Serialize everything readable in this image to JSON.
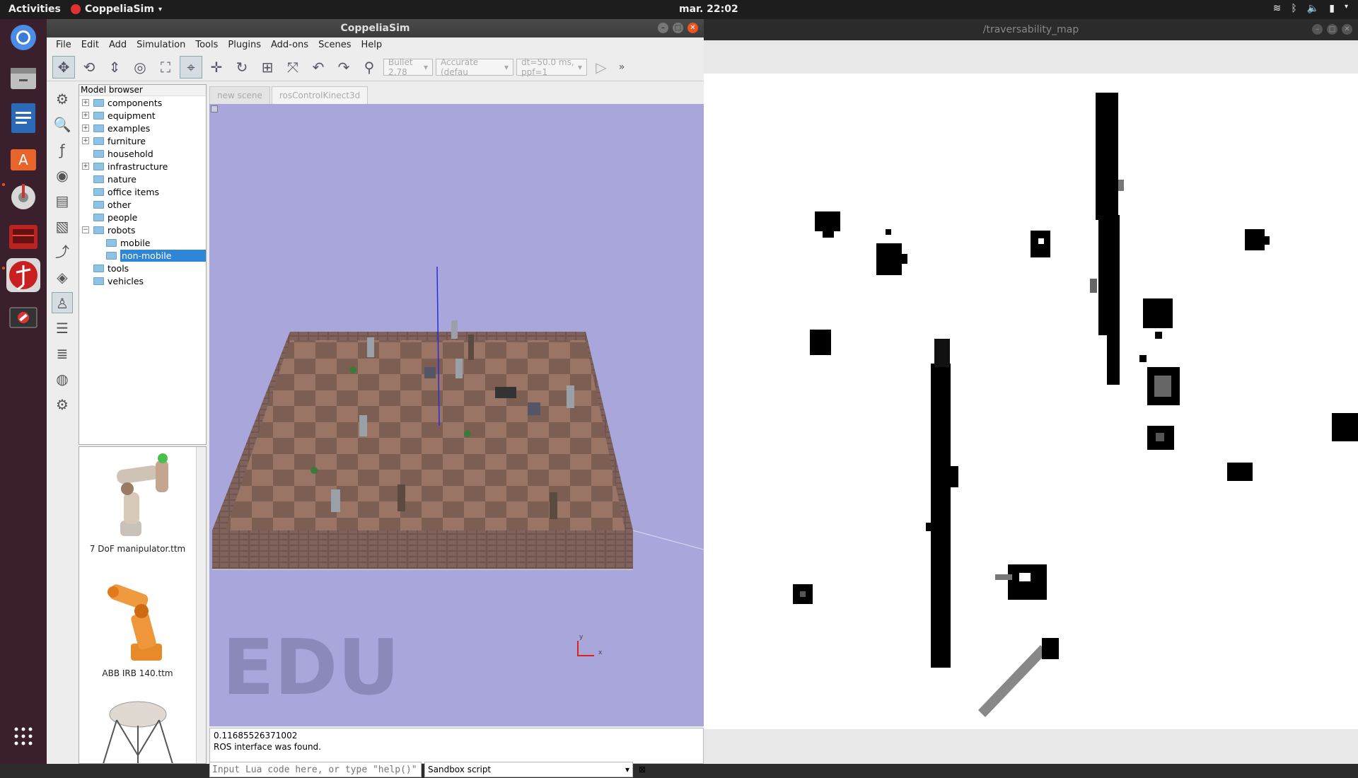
{
  "topbar": {
    "activities": "Activities",
    "app_name": "CoppeliaSim",
    "clock": "mar. 22:02"
  },
  "dock": {
    "items": [
      "chrome-icon",
      "files-icon",
      "writer-icon",
      "software-center-icon",
      "settings-icon",
      "matlab-icon",
      "coppelia-edu-icon",
      "blocked-icon",
      "app-grid-icon"
    ]
  },
  "coppelia": {
    "title": "CoppeliaSim",
    "menu": [
      "File",
      "Edit",
      "Add",
      "Simulation",
      "Tools",
      "Plugins",
      "Add-ons",
      "Scenes",
      "Help"
    ],
    "toolbar": {
      "engine": "Bullet 2.78",
      "accuracy": "Accurate (defau",
      "timestep": "dt=50.0 ms, ppf=1"
    },
    "model_browser": {
      "header": "Model browser",
      "items": [
        {
          "label": "components",
          "expander": "+"
        },
        {
          "label": "equipment",
          "expander": "+"
        },
        {
          "label": "examples",
          "expander": "+"
        },
        {
          "label": "furniture",
          "expander": "+"
        },
        {
          "label": "household",
          "expander": ""
        },
        {
          "label": "infrastructure",
          "expander": "+"
        },
        {
          "label": "nature",
          "expander": ""
        },
        {
          "label": "office items",
          "expander": ""
        },
        {
          "label": "other",
          "expander": ""
        },
        {
          "label": "people",
          "expander": ""
        },
        {
          "label": "robots",
          "expander": "−"
        },
        {
          "label": "mobile",
          "expander": ""
        },
        {
          "label": "non-mobile",
          "expander": ""
        },
        {
          "label": "tools",
          "expander": ""
        },
        {
          "label": "vehicles",
          "expander": ""
        }
      ]
    },
    "thumbnails": [
      {
        "label": "7 DoF manipulator.ttm"
      },
      {
        "label": "ABB IRB 140.ttm"
      }
    ],
    "tabs": [
      "new scene",
      "rosControlKinect3d"
    ],
    "scene": {
      "watermark": "EDU",
      "axis_y": "y",
      "axis_x": "x"
    },
    "console": {
      "line1": "0.11685526371002",
      "line2": "ROS interface was found."
    },
    "command": {
      "placeholder": "Input Lua code here, or type \"help()\"",
      "script_select": "Sandbox script"
    }
  },
  "map_window": {
    "title": "/traversability_map"
  }
}
